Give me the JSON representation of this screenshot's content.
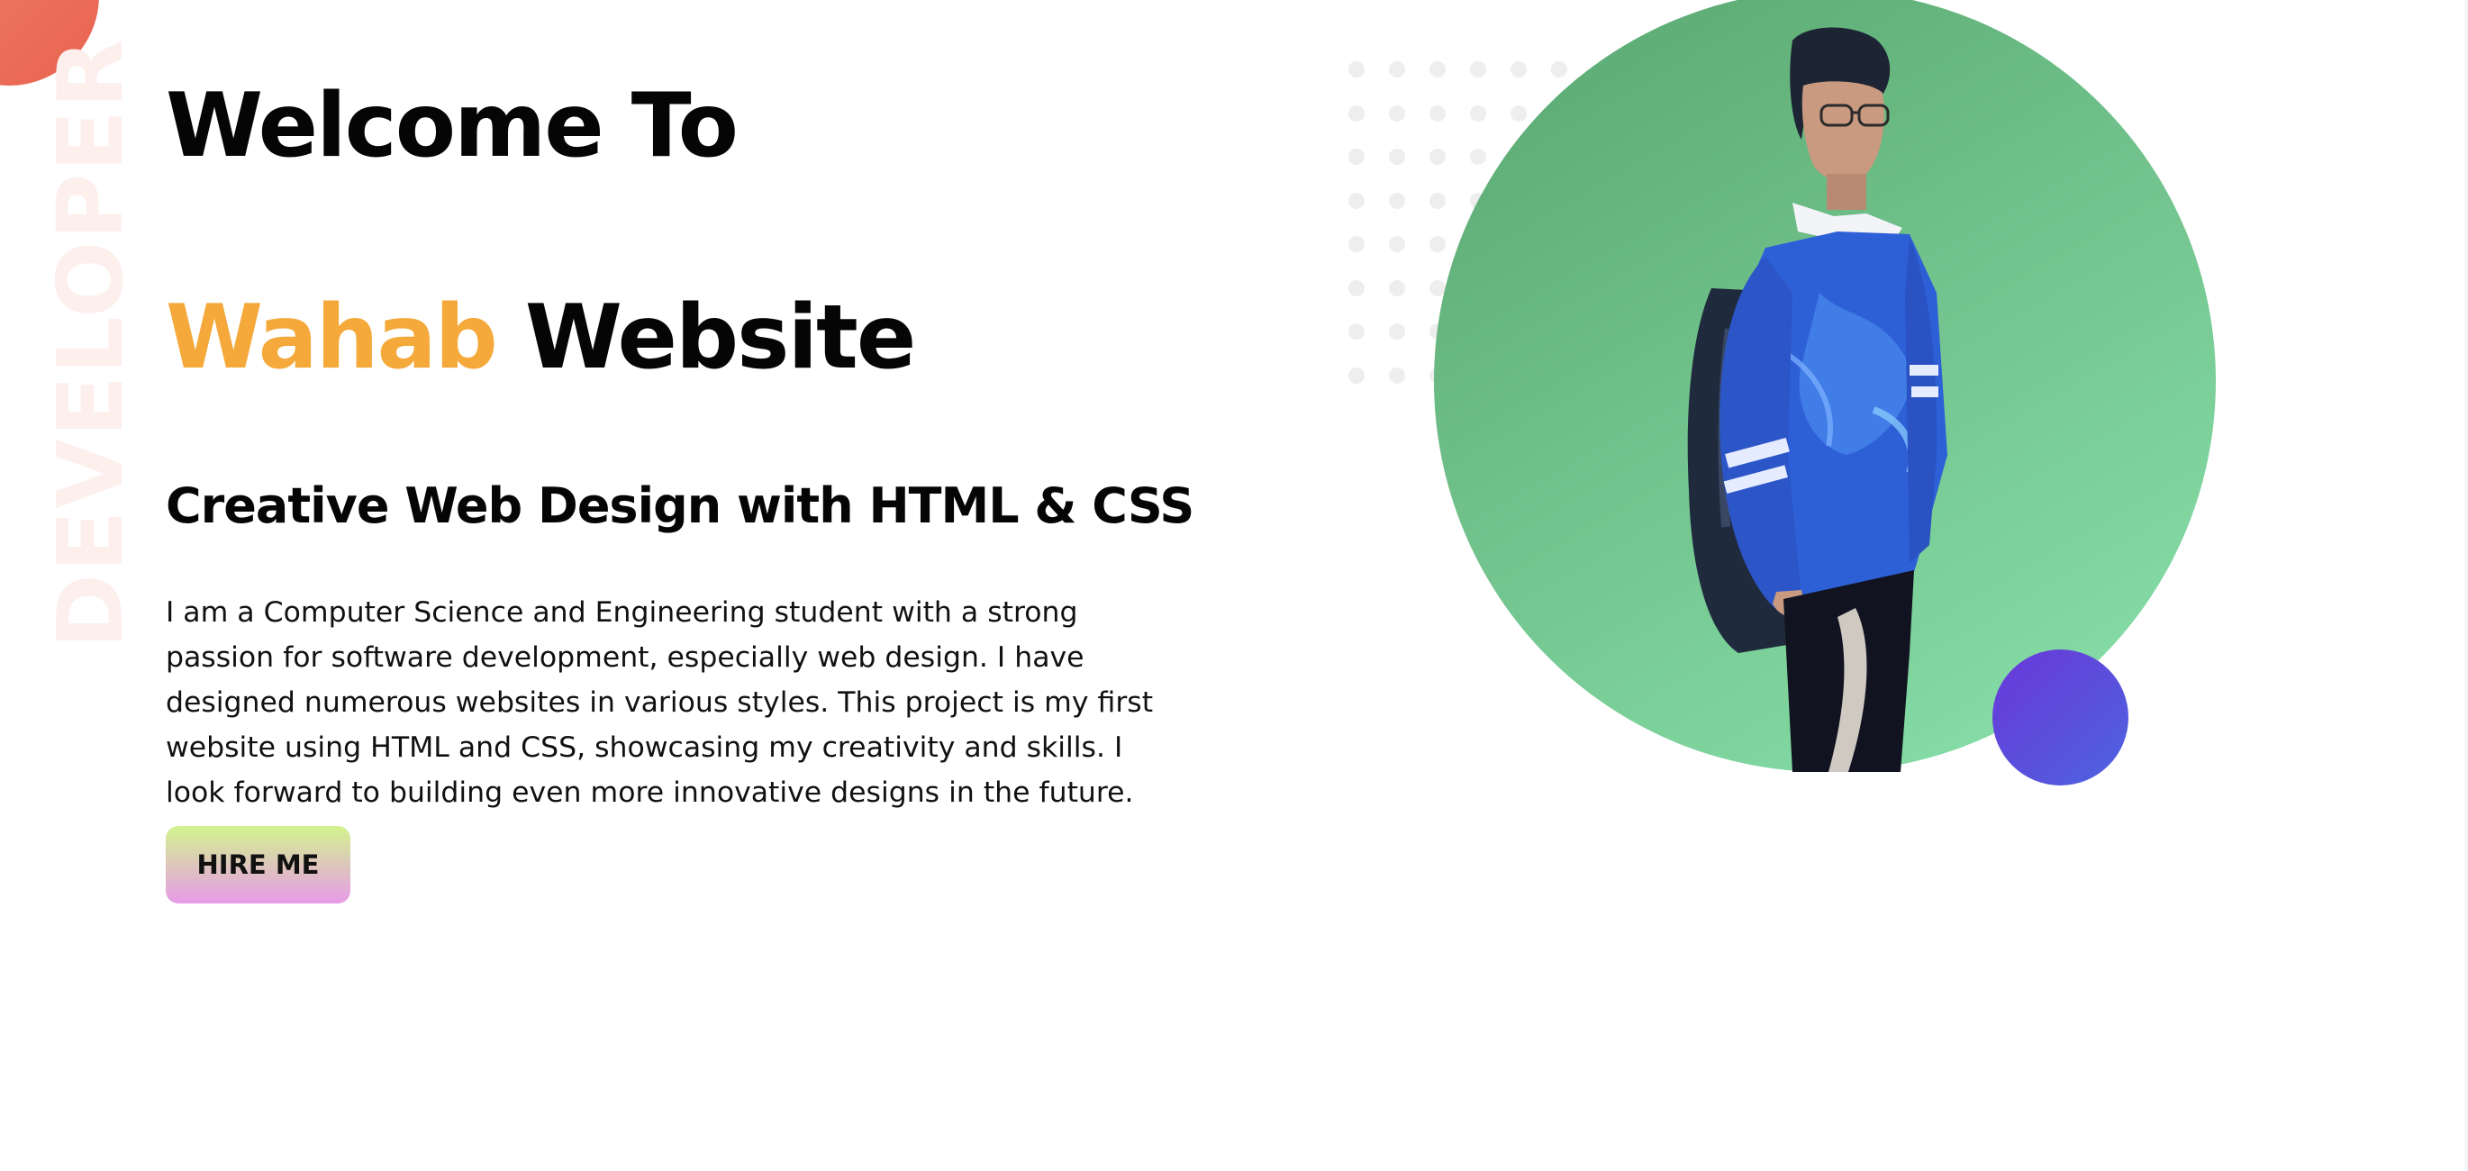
{
  "side_word": "DEVELOPER",
  "hero": {
    "title_line1": "Welcome To",
    "title_accent": "Wahab",
    "title_rest": " Website",
    "subtitle": "Creative Web Design with HTML & CSS",
    "description": "I am a Computer Science and Engineering student with a strong passion for software development, especially web design. I have designed numerous websites in various styles. This project is my first website using HTML and CSS, showcasing my creativity and skills. I look forward to building even more innovative designs in the future.",
    "cta_label": "HIRE ME"
  },
  "colors": {
    "accent": "#f4a93a",
    "hero_circle": "#73c48e",
    "purple_dot": "#5a4fdc",
    "corner_blob": "#e8634f"
  }
}
